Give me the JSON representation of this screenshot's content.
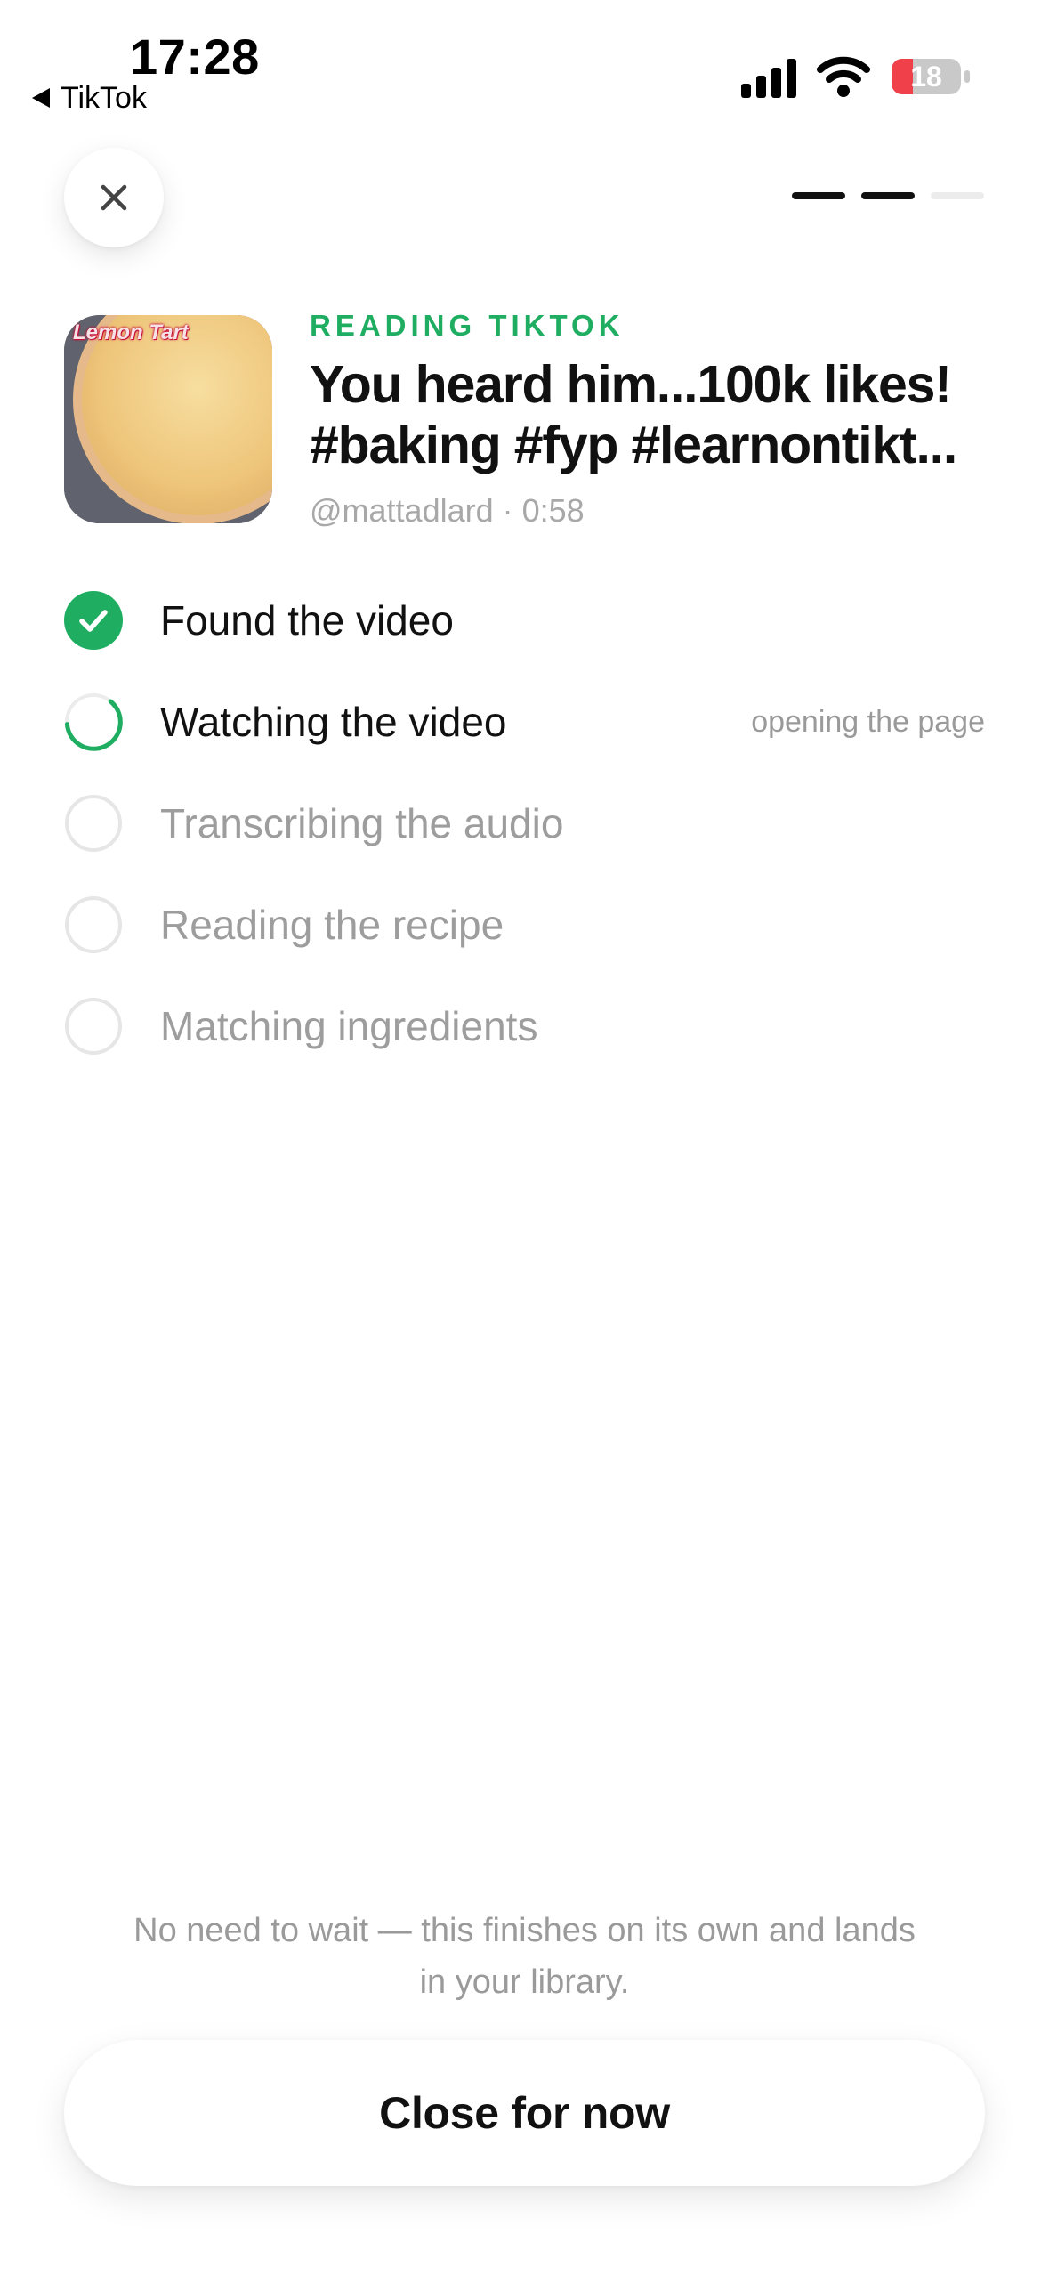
{
  "status_bar": {
    "time": "17:28",
    "back_app": "TikTok",
    "battery_level": "18",
    "icons": [
      "signal-icon",
      "wifi-icon",
      "battery-icon"
    ]
  },
  "header": {
    "close_icon": "close-icon",
    "step_count": 3,
    "step_current": 2
  },
  "video": {
    "thumbnail_label": "Lemon Tart",
    "eyebrow": "READING TIKTOK",
    "title_line1": "You heard him...100k likes!",
    "title_line2": "#baking #fyp #learnontikt...",
    "meta": "@mattadlard · 0:58"
  },
  "steps": [
    {
      "label": "Found the video",
      "status": "done",
      "sub": ""
    },
    {
      "label": "Watching the video",
      "status": "active",
      "sub": "opening the page"
    },
    {
      "label": "Transcribing the audio",
      "status": "pending",
      "sub": ""
    },
    {
      "label": "Reading the recipe",
      "status": "pending",
      "sub": ""
    },
    {
      "label": "Matching ingredients",
      "status": "pending",
      "sub": ""
    }
  ],
  "footer": {
    "note_line1": "No need to wait — this finishes on its own and lands",
    "note_line2": "in your library.",
    "close_label": "Close for now"
  },
  "colors": {
    "accent": "#1fae61",
    "battery_low": "#f0404a",
    "text": "#111111",
    "muted": "#9d9d9d"
  }
}
